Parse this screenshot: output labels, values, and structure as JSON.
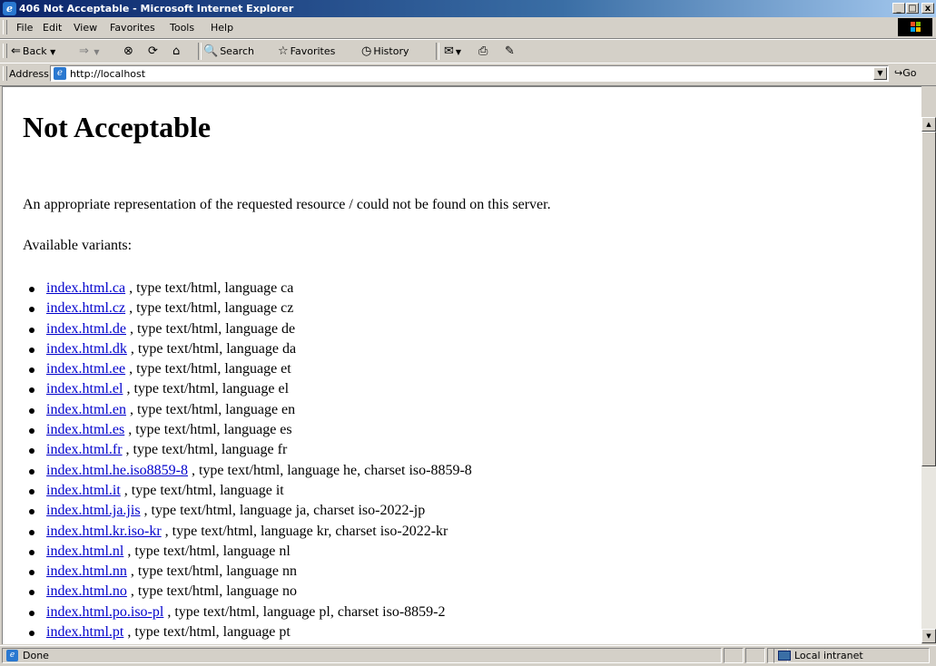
{
  "window": {
    "title": "406 Not Acceptable - Microsoft Internet Explorer",
    "minimize": "_",
    "maximize": "□",
    "close": "x"
  },
  "menu": [
    "File",
    "Edit",
    "View",
    "Favorites",
    "Tools",
    "Help"
  ],
  "toolbar": {
    "back": "Back",
    "search": "Search",
    "favorites": "Favorites",
    "history": "History"
  },
  "address": {
    "label": "Address",
    "value": "http://localhost",
    "go": "Go"
  },
  "page": {
    "heading": "Not Acceptable",
    "message": "An appropriate representation of the requested resource / could not be found on this server.",
    "variants_label": "Available variants:",
    "variants": [
      {
        "link": "index.html.ca",
        "desc": " , type text/html, language ca"
      },
      {
        "link": "index.html.cz",
        "desc": " , type text/html, language cz"
      },
      {
        "link": "index.html.de",
        "desc": " , type text/html, language de"
      },
      {
        "link": "index.html.dk",
        "desc": " , type text/html, language da"
      },
      {
        "link": "index.html.ee",
        "desc": " , type text/html, language et"
      },
      {
        "link": "index.html.el",
        "desc": " , type text/html, language el"
      },
      {
        "link": "index.html.en",
        "desc": " , type text/html, language en"
      },
      {
        "link": "index.html.es",
        "desc": " , type text/html, language es"
      },
      {
        "link": "index.html.fr",
        "desc": " , type text/html, language fr"
      },
      {
        "link": "index.html.he.iso8859-8",
        "desc": " , type text/html, language he, charset iso-8859-8"
      },
      {
        "link": "index.html.it",
        "desc": " , type text/html, language it"
      },
      {
        "link": "index.html.ja.jis",
        "desc": " , type text/html, language ja, charset iso-2022-jp"
      },
      {
        "link": "index.html.kr.iso-kr",
        "desc": " , type text/html, language kr, charset iso-2022-kr"
      },
      {
        "link": "index.html.nl",
        "desc": " , type text/html, language nl"
      },
      {
        "link": "index.html.nn",
        "desc": " , type text/html, language nn"
      },
      {
        "link": "index.html.no",
        "desc": " , type text/html, language no"
      },
      {
        "link": "index.html.po.iso-pl",
        "desc": " , type text/html, language pl, charset iso-8859-2"
      },
      {
        "link": "index.html.pt",
        "desc": " , type text/html, language pt"
      }
    ]
  },
  "status": {
    "text": "Done",
    "zone": "Local intranet"
  }
}
